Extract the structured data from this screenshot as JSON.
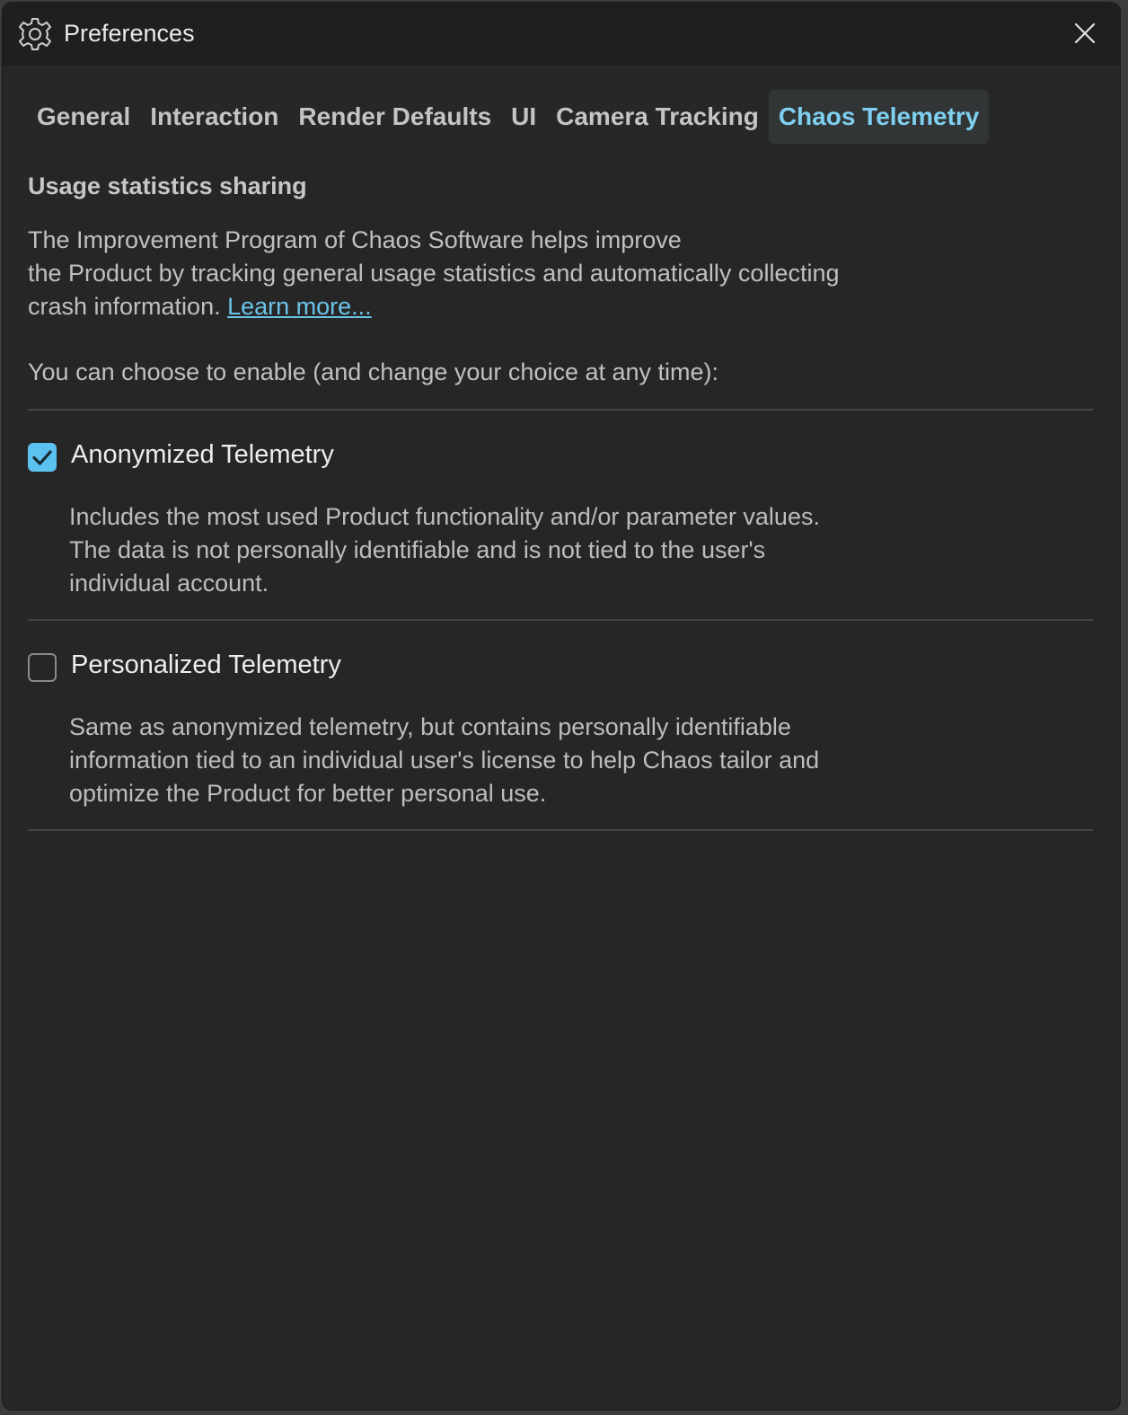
{
  "window": {
    "title": "Preferences",
    "gear_icon": "gear-icon",
    "close_icon": "close-icon"
  },
  "tabs": [
    {
      "label": "General",
      "active": false
    },
    {
      "label": "Interaction",
      "active": false
    },
    {
      "label": "Render Defaults",
      "active": false
    },
    {
      "label": "UI",
      "active": false
    },
    {
      "label": "Camera Tracking",
      "active": false
    },
    {
      "label": "Chaos Telemetry",
      "active": true
    }
  ],
  "telemetry": {
    "section_title": "Usage statistics sharing",
    "intro_line1": "The Improvement Program of Chaos Software helps improve",
    "intro_line2": "the Product by tracking general usage statistics and automatically collecting",
    "intro_line3": "crash information.",
    "learn_more": "Learn more...",
    "choose_text": "You can choose to enable (and change your choice at any time):",
    "options": [
      {
        "label": "Anonymized Telemetry",
        "checked": true,
        "desc_line1": "Includes the most used Product functionality and/or parameter values.",
        "desc_line2": "The data is not personally identifiable and is not tied to the user's",
        "desc_line3": "individual account."
      },
      {
        "label": "Personalized Telemetry",
        "checked": false,
        "desc_line1": "Same as anonymized telemetry, but contains personally identifiable",
        "desc_line2": "information tied to an individual user's license to help Chaos tailor and",
        "desc_line3": "optimize the Product for better personal use."
      }
    ]
  },
  "colors": {
    "accent": "#5bc2ef",
    "active_tab_text": "#7fd0f0",
    "link": "#6cc3ea",
    "window_bg": "#272727",
    "titlebar_bg": "#1f1f1f"
  }
}
